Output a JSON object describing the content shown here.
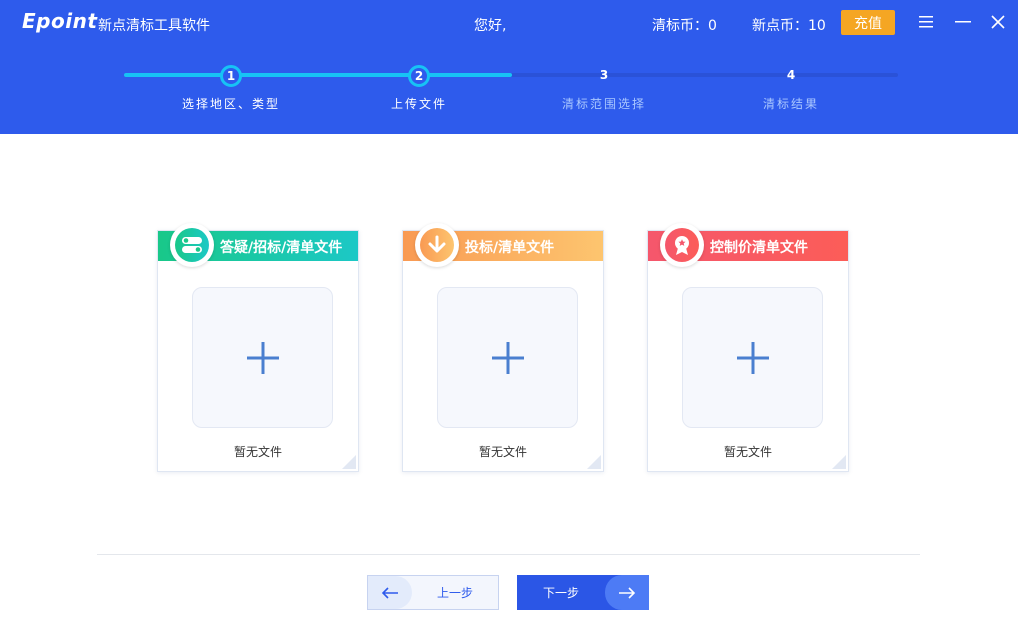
{
  "header": {
    "logo": "Epoint",
    "app_title": "新点清标工具软件",
    "greeting": "您好,",
    "qingbiao_coin": "清标币：0",
    "xindian_coin": "新点币：10",
    "recharge_label": "充值"
  },
  "steps": [
    {
      "number": "1",
      "label": "选择地区、类型",
      "status": "done"
    },
    {
      "number": "2",
      "label": "上传文件",
      "status": "current"
    },
    {
      "number": "3",
      "label": "清标范围选择",
      "status": "todo"
    },
    {
      "number": "4",
      "label": "清标结果",
      "status": "todo"
    }
  ],
  "cards": [
    {
      "title": "答疑/招标/清单文件",
      "empty_text": "暂无文件",
      "icon": "toggle-icon",
      "color": "#19c889"
    },
    {
      "title": "投标/清单文件",
      "empty_text": "暂无文件",
      "icon": "download-arrow-icon",
      "color": "#f99a53"
    },
    {
      "title": "控制价清单文件",
      "empty_text": "暂无文件",
      "icon": "medal-icon",
      "color": "#f5576c"
    }
  ],
  "footer": {
    "prev_label": "上一步",
    "next_label": "下一步"
  },
  "colors": {
    "primary": "#2e5bec",
    "active_step": "#17c3f5",
    "recharge": "#f5a623"
  }
}
